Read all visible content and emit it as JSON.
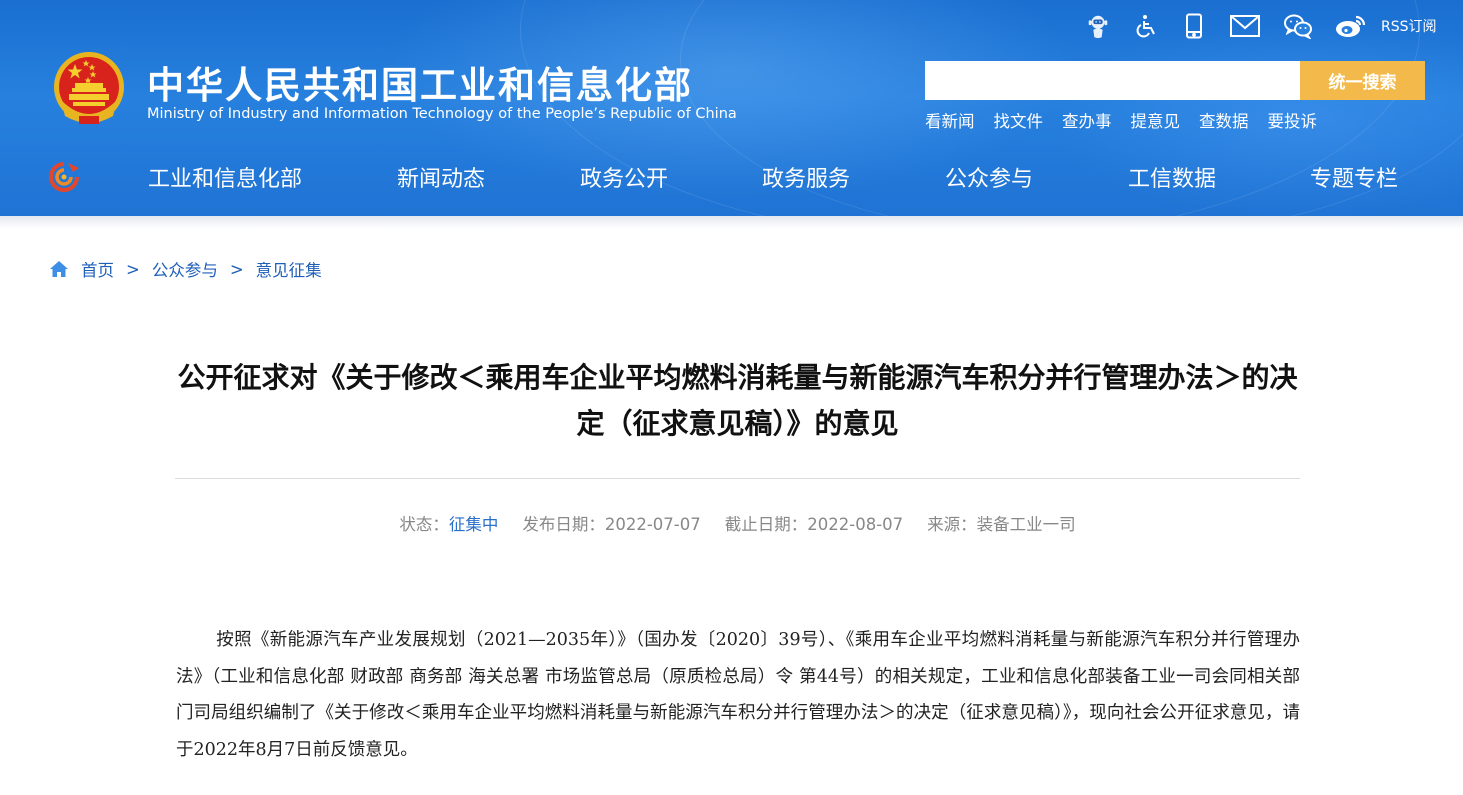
{
  "header": {
    "title": "中华人民共和国工业和信息化部",
    "subtitle": "Ministry of Industry and Information Technology of the People’s Republic of China",
    "top_icons": [
      "robot-assistant-icon",
      "accessibility-icon",
      "mobile-icon",
      "mail-icon",
      "wechat-icon",
      "weibo-icon"
    ],
    "rss_label": "RSS订阅",
    "search": {
      "placeholder": "",
      "value": "",
      "button_label": "统一搜索"
    },
    "quick_links": [
      "看新闻",
      "找文件",
      "查办事",
      "提意见",
      "查数据",
      "要投诉"
    ],
    "nav": [
      "工业和信息化部",
      "新闻动态",
      "政务公开",
      "政务服务",
      "公众参与",
      "工信数据",
      "专题专栏"
    ]
  },
  "breadcrumb": {
    "home": "首页",
    "separator": ">",
    "items": [
      "公众参与",
      "意见征集"
    ]
  },
  "article": {
    "title": "公开征求对《关于修改＜乘用车企业平均燃料消耗量与新能源汽车积分并行管理办法＞的决定（征求意见稿）》的意见",
    "meta": {
      "status_label": "状态：",
      "status_value": "征集中",
      "publish_label": "发布日期：",
      "publish_value": "2022-07-07",
      "deadline_label": "截止日期：",
      "deadline_value": "2022-08-07",
      "source_label": "来源：",
      "source_value": "装备工业一司"
    },
    "body": "按照《新能源汽车产业发展规划（2021—2035年）》（国办发〔2020〕39号）、《乘用车企业平均燃料消耗量与新能源汽车积分并行管理办法》（工业和信息化部 财政部 商务部 海关总署 市场监管总局（原质检总局）令 第44号）的相关规定，工业和信息化部装备工业一司会同相关部门司局组织编制了《关于修改＜乘用车企业平均燃料消耗量与新能源汽车积分并行管理办法＞的决定（征求意见稿）》，现向社会公开征求意见，请于2022年8月7日前反馈意见。"
  },
  "colors": {
    "header_blue": "#2780de",
    "search_button": "#f3b94a",
    "link_blue": "#1f5fb8",
    "status_blue": "#2a6fc9"
  }
}
